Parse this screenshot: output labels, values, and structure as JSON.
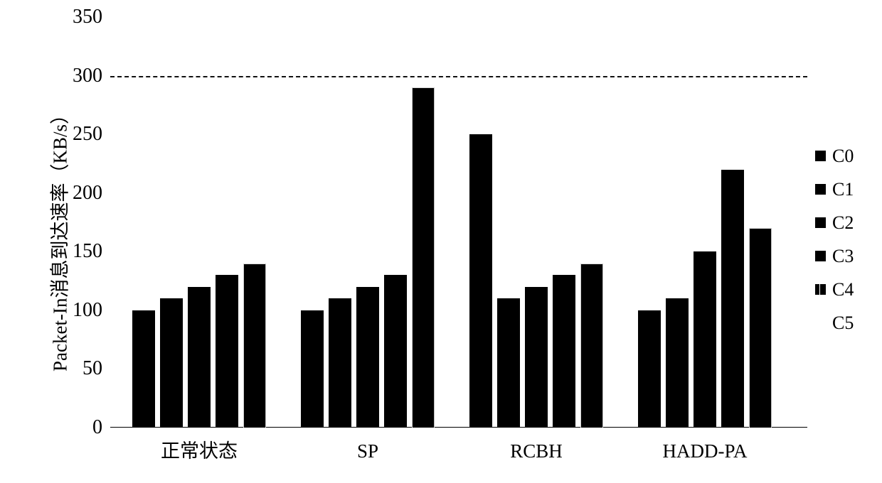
{
  "chart_data": {
    "type": "bar",
    "title": "",
    "subtitle": "",
    "xlabel": "",
    "ylabel": "Packet-In消息到达速率（KB/s）",
    "categories": [
      "正常状态",
      "SP",
      "RCBH",
      "HADD-PA"
    ],
    "series": [
      {
        "name": "C0",
        "values": [
          100,
          100,
          250,
          100
        ]
      },
      {
        "name": "C1",
        "values": [
          110,
          110,
          110,
          110
        ]
      },
      {
        "name": "C2",
        "values": [
          120,
          120,
          120,
          150
        ]
      },
      {
        "name": "C3",
        "values": [
          130,
          130,
          130,
          220
        ]
      },
      {
        "name": "C4",
        "values": [
          140,
          290,
          140,
          170
        ]
      },
      {
        "name": "C5",
        "values": [
          null,
          null,
          null,
          null
        ]
      }
    ],
    "ylim": [
      0,
      350
    ],
    "yticks": [
      0,
      50,
      100,
      150,
      200,
      250,
      300,
      350
    ],
    "ytick_labels": [
      "0",
      "50",
      "100",
      "150",
      "200",
      "250",
      "300",
      "350"
    ],
    "grid": false,
    "legend_position": "right",
    "legend_entries": [
      "C0",
      "C1",
      "C2",
      "C3",
      "C4",
      "C5"
    ],
    "annotations": [
      {
        "type": "threshold-line",
        "style": "dashed",
        "value": 300,
        "label": ""
      }
    ],
    "bar_color": "#000000"
  },
  "axis": {
    "y_title": "Packet-In消息到达速率（KB/s）",
    "ticks": [
      {
        "label": "350",
        "value": 350
      },
      {
        "label": "300",
        "value": 300
      },
      {
        "label": "250",
        "value": 250
      },
      {
        "label": "200",
        "value": 200
      },
      {
        "label": "150",
        "value": 150
      },
      {
        "label": "100",
        "value": 100
      },
      {
        "label": "50",
        "value": 50
      },
      {
        "label": "0",
        "value": 0
      }
    ]
  },
  "groups": [
    {
      "label": "正常状态",
      "bars": [
        100,
        110,
        120,
        130,
        140
      ]
    },
    {
      "label": "SP",
      "bars": [
        100,
        110,
        120,
        130,
        290
      ]
    },
    {
      "label": "RCBH",
      "bars": [
        250,
        110,
        120,
        130,
        140
      ]
    },
    {
      "label": "HADD-PA",
      "bars": [
        100,
        110,
        150,
        220,
        170
      ]
    }
  ],
  "legend": {
    "items": [
      {
        "label": "C0",
        "marker": "filled"
      },
      {
        "label": "C1",
        "marker": "filled"
      },
      {
        "label": "C2",
        "marker": "filled"
      },
      {
        "label": "C3",
        "marker": "filled"
      },
      {
        "label": "C4",
        "marker": "noisy"
      },
      {
        "label": "C5",
        "marker": "blank"
      }
    ]
  }
}
